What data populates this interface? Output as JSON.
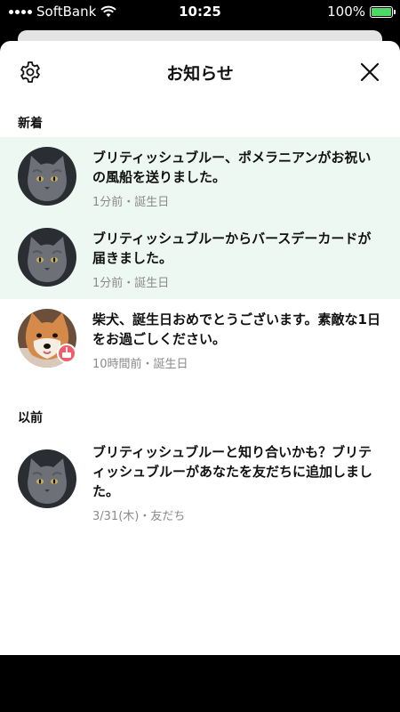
{
  "status_bar": {
    "carrier": "SoftBank",
    "time": "10:25",
    "battery": "100%"
  },
  "header": {
    "title": "お知らせ"
  },
  "sections": [
    {
      "label": "新着",
      "items": [
        {
          "message": "ブリティッシュブルー、ポメラニアンがお祝いの風船を送りました。",
          "meta": "1分前・誕生日",
          "avatar": "grey-cat-avatar",
          "unread": true
        },
        {
          "message": "ブリティッシュブルーからバースデーカードが届きました。",
          "meta": "1分前・誕生日",
          "avatar": "grey-cat-avatar",
          "unread": true
        },
        {
          "message": "柴犬、誕生日おめでとうございます。素敵な1日をお過ごしください。",
          "meta": "10時間前・誕生日",
          "avatar": "shiba-dog-avatar",
          "unread": false,
          "badge": "birthday-cake-icon"
        }
      ]
    },
    {
      "label": "以前",
      "items": [
        {
          "message": "ブリティッシュブルーと知り合いかも？ブリティッシュブルーがあなたを友だちに追加しました。",
          "meta": "3/31(木)・友だち",
          "avatar": "grey-cat-avatar",
          "unread": false
        }
      ]
    }
  ],
  "colors": {
    "unread_bg": "#eef8f2",
    "meta_text": "#8a8a8a",
    "badge": "#ec5f6c",
    "battery_fill": "#4cd964"
  }
}
